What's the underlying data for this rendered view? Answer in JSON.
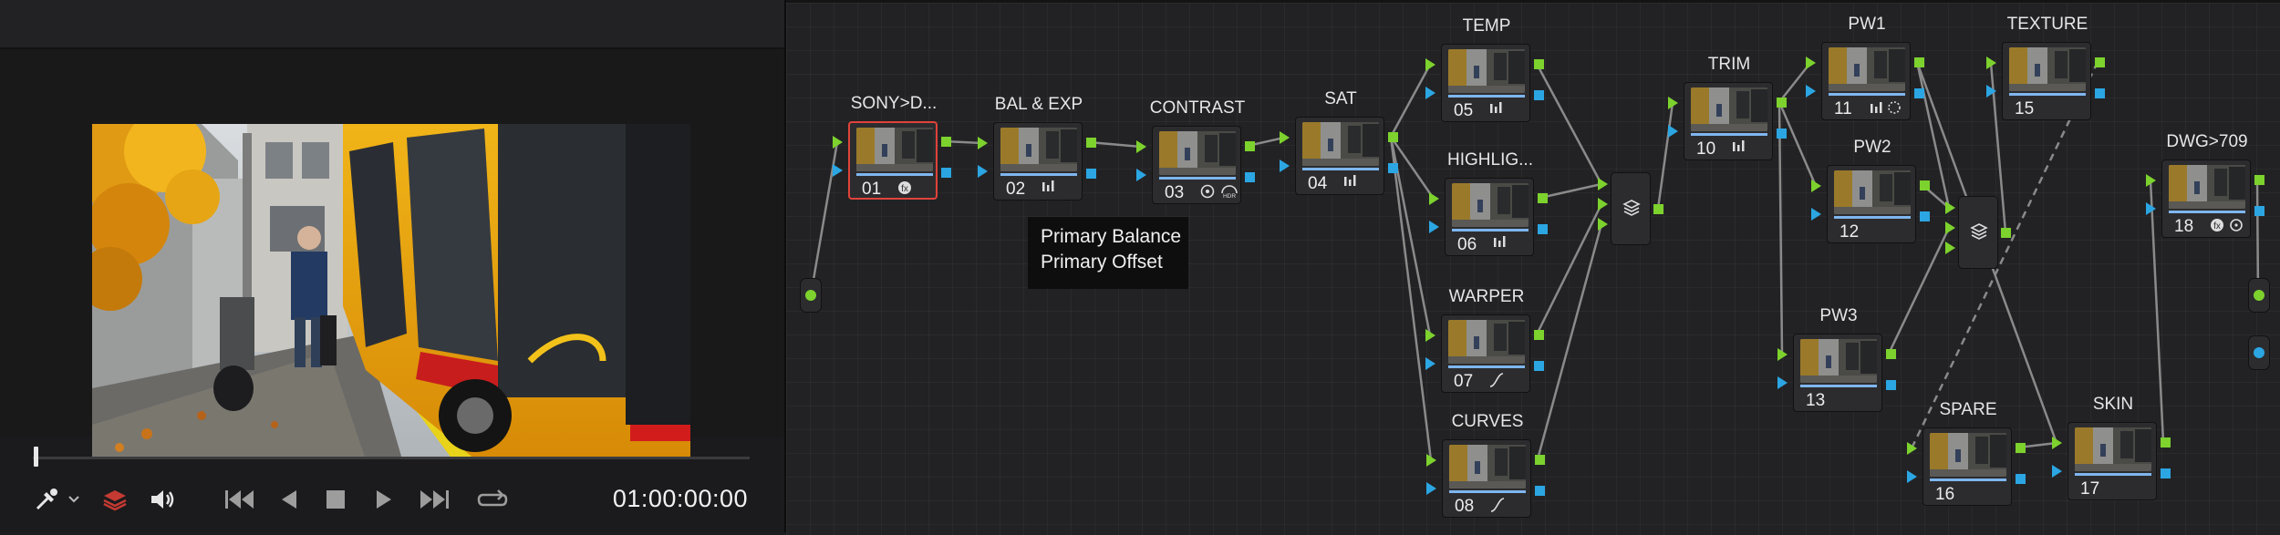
{
  "viewer": {
    "timecode": "01:00:00:00",
    "controls": [
      {
        "name": "color-picker-icon"
      },
      {
        "name": "chevron-down-icon"
      },
      {
        "name": "layers-icon"
      },
      {
        "name": "speaker-icon"
      },
      {
        "name": "jump-to-first-frame-icon"
      },
      {
        "name": "play-reverse-icon"
      },
      {
        "name": "stop-icon"
      },
      {
        "name": "play-icon"
      },
      {
        "name": "jump-to-last-frame-icon"
      },
      {
        "name": "loop-icon"
      }
    ]
  },
  "tooltip": {
    "line1": "Primary Balance",
    "line2": "Primary Offset"
  },
  "nodes": [
    {
      "id": "01",
      "label": "SONY>D...",
      "icons": "fx",
      "selected": true
    },
    {
      "id": "02",
      "label": "BAL & EXP",
      "icons": "bars"
    },
    {
      "id": "03",
      "label": "CONTRAST",
      "icons": "hdr"
    },
    {
      "id": "04",
      "label": "SAT",
      "icons": "bars"
    },
    {
      "id": "05",
      "label": "TEMP",
      "icons": "bars"
    },
    {
      "id": "06",
      "label": "HIGHLIG...",
      "icons": "bars"
    },
    {
      "id": "07",
      "label": "WARPER",
      "icons": "curve"
    },
    {
      "id": "08",
      "label": "CURVES",
      "icons": "curve"
    },
    {
      "id": "10",
      "label": "TRIM",
      "icons": "bars"
    },
    {
      "id": "11",
      "label": "PW1",
      "icons": "bars-window"
    },
    {
      "id": "12",
      "label": "PW2",
      "icons": ""
    },
    {
      "id": "13",
      "label": "PW3",
      "icons": ""
    },
    {
      "id": "15",
      "label": "TEXTURE",
      "icons": ""
    },
    {
      "id": "16",
      "label": "SPARE",
      "icons": ""
    },
    {
      "id": "17",
      "label": "SKIN",
      "icons": ""
    },
    {
      "id": "18",
      "label": "DWG>709",
      "icons": "fx-window"
    }
  ],
  "colors": {
    "output_port": "#7dd22e",
    "key_port": "#2ba6e3",
    "selected_border": "#e0433a",
    "link": "#8a8a8a"
  }
}
